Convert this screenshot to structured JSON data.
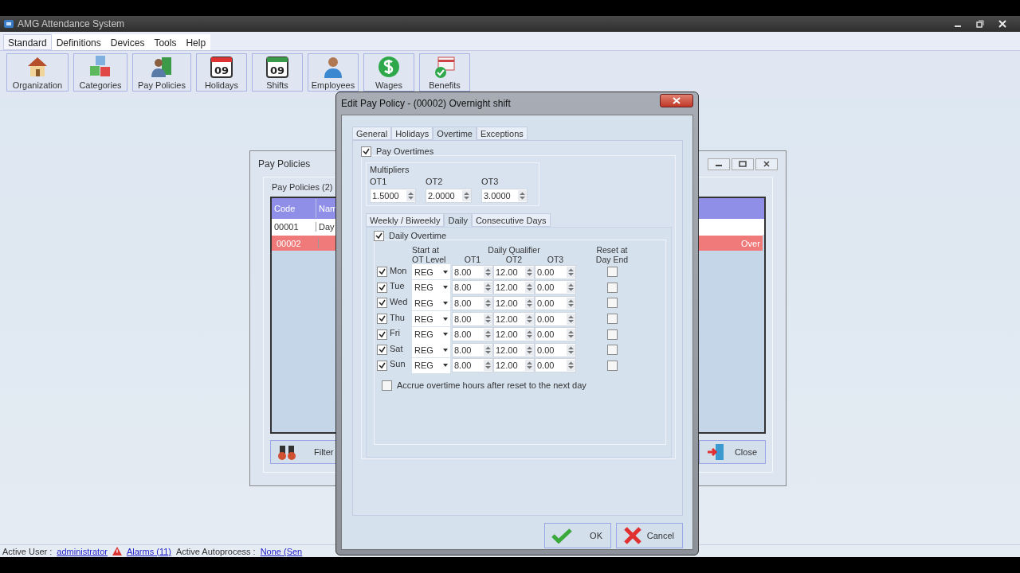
{
  "app": {
    "title": "AMG Attendance System"
  },
  "menu": [
    {
      "label": "Standard",
      "selected": true
    },
    {
      "label": "Definitions",
      "selected": false
    },
    {
      "label": "Devices",
      "selected": false
    },
    {
      "label": "Tools",
      "selected": false
    },
    {
      "label": "Help",
      "selected": false
    }
  ],
  "toolbar": [
    {
      "label": "Organization"
    },
    {
      "label": "Categories"
    },
    {
      "label": "Pay Policies"
    },
    {
      "label": "Holidays",
      "icon_text": "09"
    },
    {
      "label": "Shifts",
      "icon_text": "09"
    },
    {
      "label": "Employees"
    },
    {
      "label": "Wages"
    },
    {
      "label": "Benefits"
    }
  ],
  "pay_policies_window": {
    "title": "Pay Policies",
    "group_label": "Pay Policies (2)",
    "columns": [
      "Code",
      "Nam"
    ],
    "rows": [
      {
        "cells": [
          "00001",
          "Day"
        ],
        "selected": false
      },
      {
        "cells": [
          "00002",
          "Over"
        ],
        "selected": true
      }
    ],
    "filter_button": "Filter",
    "close_button": "Close"
  },
  "dialog": {
    "title": "Edit Pay Policy - (00002) Overnight shift",
    "tabs": [
      {
        "label": "General",
        "selected": false
      },
      {
        "label": "Holidays",
        "selected": false
      },
      {
        "label": "Overtime",
        "selected": true
      },
      {
        "label": "Exceptions",
        "selected": false
      }
    ],
    "pay_overtimes": {
      "label": "Pay Overtimes",
      "checked": true
    },
    "multipliers": {
      "title": "Multipliers",
      "fields": [
        {
          "label": "OT1",
          "value": "1.5000"
        },
        {
          "label": "OT2",
          "value": "2.0000"
        },
        {
          "label": "OT3",
          "value": "3.0000"
        }
      ]
    },
    "subtabs": [
      {
        "label": "Weekly / Biweekly",
        "selected": false
      },
      {
        "label": "Daily",
        "selected": true
      },
      {
        "label": "Consecutive Days",
        "selected": false
      }
    ],
    "daily_overtime": {
      "label": "Daily Overtime",
      "checked": true
    },
    "headers": {
      "start": "Start at\nOT Level",
      "qualifier": "Daily Qualifier",
      "ot": [
        "OT1",
        "OT2",
        "OT3"
      ],
      "reset": "Reset at\nDay End"
    },
    "days": [
      {
        "day": "Mon",
        "checked": true,
        "level": "REG",
        "ot1": "8.00",
        "ot2": "12.00",
        "ot3": "0.00",
        "reset": false
      },
      {
        "day": "Tue",
        "checked": true,
        "level": "REG",
        "ot1": "8.00",
        "ot2": "12.00",
        "ot3": "0.00",
        "reset": false
      },
      {
        "day": "Wed",
        "checked": true,
        "level": "REG",
        "ot1": "8.00",
        "ot2": "12.00",
        "ot3": "0.00",
        "reset": false
      },
      {
        "day": "Thu",
        "checked": true,
        "level": "REG",
        "ot1": "8.00",
        "ot2": "12.00",
        "ot3": "0.00",
        "reset": false
      },
      {
        "day": "Fri",
        "checked": true,
        "level": "REG",
        "ot1": "8.00",
        "ot2": "12.00",
        "ot3": "0.00",
        "reset": false
      },
      {
        "day": "Sat",
        "checked": true,
        "level": "REG",
        "ot1": "8.00",
        "ot2": "12.00",
        "ot3": "0.00",
        "reset": false
      },
      {
        "day": "Sun",
        "checked": true,
        "level": "REG",
        "ot1": "8.00",
        "ot2": "12.00",
        "ot3": "0.00",
        "reset": false
      }
    ],
    "accrue": {
      "label": "Accrue overtime hours after reset to the next day",
      "checked": false
    },
    "ok_button": "OK",
    "cancel_button": "Cancel"
  },
  "status_bar": {
    "user_label": "Active User :",
    "user": "administrator",
    "alarms": "Alarms (11)",
    "autoprocess_label": "Active Autoprocess :",
    "autoprocess": "None (Sen"
  }
}
